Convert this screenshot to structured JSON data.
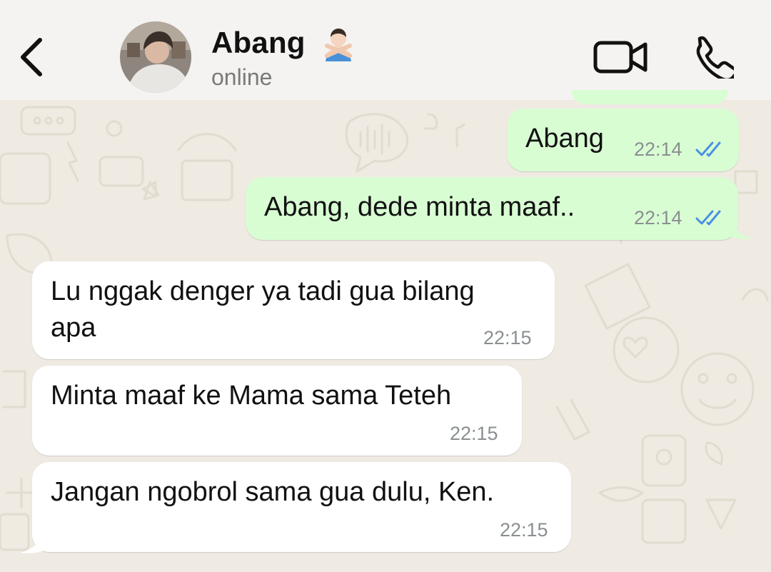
{
  "header": {
    "contact_name": "Abang",
    "status": "online",
    "emoji_icon": "person-gesturing-no-emoji",
    "back_icon": "chevron-left-icon",
    "video_icon": "video-camera-icon",
    "call_icon": "phone-icon"
  },
  "colors": {
    "outgoing_bubble": "#d9fdd3",
    "incoming_bubble": "#ffffff",
    "read_ticks": "#4a90e2",
    "wallpaper": "#efeae2"
  },
  "messages": [
    {
      "direction": "outgoing",
      "text": "Abang",
      "time": "22:14",
      "read": true
    },
    {
      "direction": "outgoing",
      "text": "Abang, dede minta maaf..",
      "time": "22:14",
      "read": true
    },
    {
      "direction": "incoming",
      "text_line1": "Lu nggak denger ya tadi gua bilang",
      "text_line2": "apa",
      "time": "22:15"
    },
    {
      "direction": "incoming",
      "text": "Minta maaf ke Mama sama Teteh",
      "time": "22:15"
    },
    {
      "direction": "incoming",
      "text": "Jangan ngobrol sama gua dulu, Ken.",
      "time": "22:15"
    }
  ]
}
